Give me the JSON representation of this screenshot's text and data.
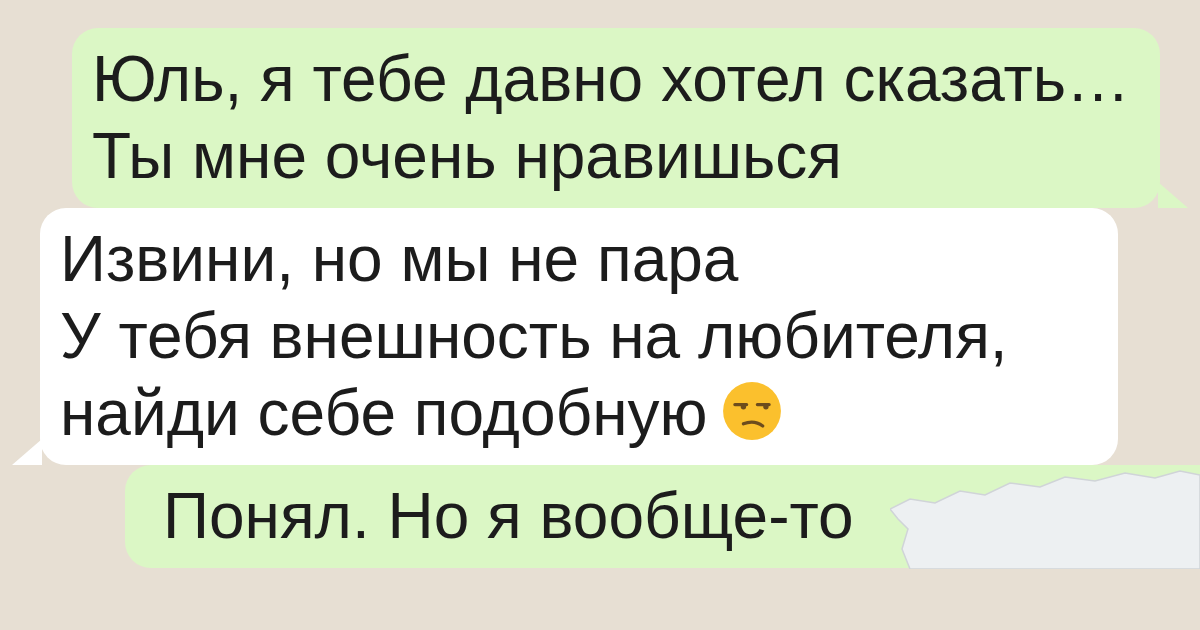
{
  "messages": [
    {
      "kind": "outgoing",
      "lines": [
        "Юль, я тебе давно хотел сказать…",
        "Ты мне очень нравишься"
      ]
    },
    {
      "kind": "incoming",
      "lines": [
        "Извини, но мы не пара",
        "У тебя внешность на любителя,",
        "найди себе подобную"
      ],
      "emoji": true
    },
    {
      "kind": "outgoing",
      "lines": [
        "Понял. Но я вообще-то"
      ],
      "covered": true
    }
  ]
}
